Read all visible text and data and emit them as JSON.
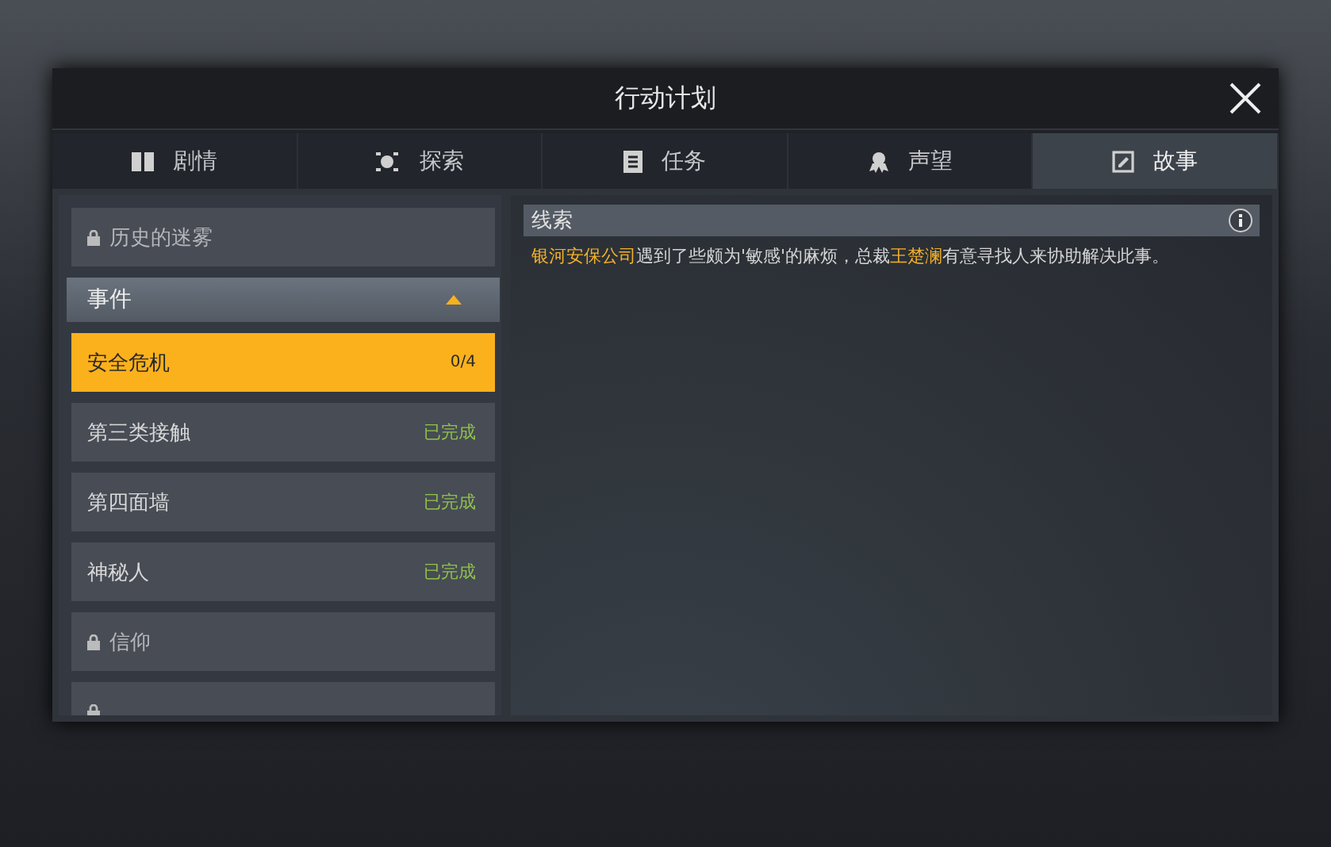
{
  "window": {
    "title": "行动计划"
  },
  "tabs": [
    {
      "label": "剧情",
      "selected": false
    },
    {
      "label": "探索",
      "selected": false
    },
    {
      "label": "任务",
      "selected": false
    },
    {
      "label": "声望",
      "selected": false
    },
    {
      "label": "故事",
      "selected": true
    }
  ],
  "sidebar": {
    "items": [
      {
        "kind": "locked",
        "label": "历史的迷雾"
      },
      {
        "kind": "header",
        "label": "事件",
        "expanded": true,
        "children": [
          {
            "label": "安全危机",
            "status": "0/4",
            "completed": false,
            "selected": true
          },
          {
            "label": "第三类接触",
            "status": "已完成",
            "completed": true,
            "selected": false
          },
          {
            "label": "第四面墙",
            "status": "已完成",
            "completed": true,
            "selected": false
          },
          {
            "label": "神秘人",
            "status": "已完成",
            "completed": true,
            "selected": false
          }
        ]
      },
      {
        "kind": "locked",
        "label": "信仰"
      },
      {
        "kind": "locked"
      }
    ]
  },
  "clue": {
    "title": "线索",
    "text": [
      {
        "text": "银河安保公司",
        "highlight": true
      },
      {
        "text": "遇到了些颇为'敏感'的麻烦，总裁",
        "highlight": false
      },
      {
        "text": "王楚澜",
        "highlight": true
      },
      {
        "text": "有意寻找人来协助解决此事。",
        "highlight": false
      }
    ]
  }
}
